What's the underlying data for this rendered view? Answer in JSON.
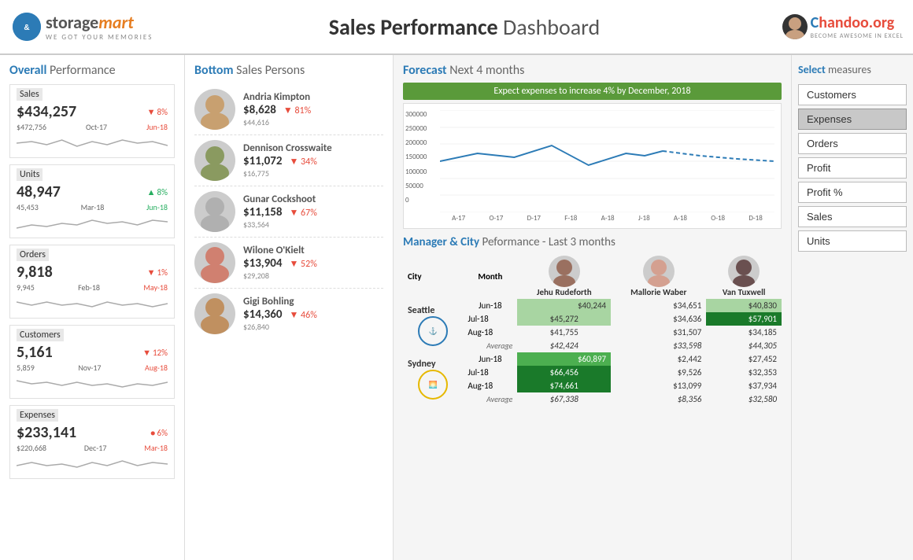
{
  "header": {
    "logo_storage": "storage",
    "logo_mart": "mart",
    "logo_sub": "WE GOT YOUR MEMORIES",
    "title_bold": "Sales Performance",
    "title_light": "Dashboard",
    "chandoo_c": "C",
    "chandoo_rest": "handoo.org",
    "chandoo_sub": "BECOME AWESOME IN EXCEL"
  },
  "left": {
    "section_bold": "Overall",
    "section_light": "Performance",
    "metrics": [
      {
        "label": "Sales",
        "value": "$434,257",
        "change": "8%",
        "direction": "down",
        "prev": "$472,756",
        "date1": "Oct-17",
        "date2": "Jun-18"
      },
      {
        "label": "Units",
        "value": "48,947",
        "change": "8%",
        "direction": "up",
        "prev": "45,453",
        "date1": "Mar-18",
        "date2": "Jun-18"
      },
      {
        "label": "Orders",
        "value": "9,818",
        "change": "1%",
        "direction": "down",
        "prev": "9,945",
        "date1": "Feb-18",
        "date2": "May-18"
      },
      {
        "label": "Customers",
        "value": "5,161",
        "change": "12%",
        "direction": "down",
        "prev": "5,859",
        "date1": "Nov-17",
        "date2": "Aug-18"
      },
      {
        "label": "Expenses",
        "value": "$233,141",
        "change": "6%",
        "direction": "dot",
        "prev": "$220,668",
        "date1": "Dec-17",
        "date2": "Mar-18"
      }
    ]
  },
  "middle": {
    "section_bold": "Bottom",
    "section_light": "Sales Persons",
    "persons": [
      {
        "name": "Andria Kimpton",
        "value": "$8,628",
        "pct": "81%",
        "prev": "$44,616",
        "color": "#c0a080"
      },
      {
        "name": "Dennison Crosswaite",
        "value": "$11,072",
        "pct": "34%",
        "prev": "$16,775",
        "color": "#8a9a60"
      },
      {
        "name": "Gunar Cockshoot",
        "value": "$11,158",
        "pct": "67%",
        "prev": "$33,564",
        "color": "#b0b0b0"
      },
      {
        "name": "Wilone O'Kielt",
        "value": "$13,904",
        "pct": "52%",
        "prev": "$29,208",
        "color": "#c08070"
      },
      {
        "name": "Gigi Bohling",
        "value": "$14,360",
        "pct": "46%",
        "prev": "$26,840",
        "color": "#c09060"
      }
    ]
  },
  "forecast": {
    "bold": "Forecast",
    "light": "Next 4 months",
    "banner": "Expect expenses to increase 4% by December, 2018",
    "y_labels": [
      "300000",
      "250000",
      "200000",
      "150000",
      "100000",
      "50000",
      "0"
    ],
    "x_labels": [
      "A-17",
      "O-17",
      "D-17",
      "F-18",
      "A-18",
      "J-18",
      "A-18",
      "O-18",
      "D-18"
    ]
  },
  "manager": {
    "bold": "Manager & City",
    "light": "Peformance - Last 3 months",
    "managers": [
      {
        "name": "Jehu Rudeforth"
      },
      {
        "name": "Mallorie Waber"
      },
      {
        "name": "Van Tuxwell"
      }
    ],
    "cities": [
      {
        "name": "Seattle",
        "rows": [
          {
            "month": "Jun-18",
            "v1": "$40,244",
            "v2": "$34,651",
            "v3": "$40,830",
            "c1": "cell-green-light",
            "c2": "cell-plain",
            "c3": "cell-green-light"
          },
          {
            "month": "Jul-18",
            "v1": "$45,272",
            "v2": "$34,636",
            "v3": "$57,901",
            "c1": "cell-green-light",
            "c2": "cell-plain",
            "c3": "cell-green-dark"
          },
          {
            "month": "Aug-18",
            "v1": "$41,755",
            "v2": "$31,507",
            "v3": "$34,185",
            "c1": "cell-plain",
            "c2": "cell-plain",
            "c3": "cell-plain"
          }
        ],
        "avg": {
          "v1": "$42,424",
          "v2": "$33,598",
          "v3": "$44,305"
        }
      },
      {
        "name": "Sydney",
        "rows": [
          {
            "month": "Jun-18",
            "v1": "$60,897",
            "v2": "$2,442",
            "v3": "$27,452",
            "c1": "cell-green-mid",
            "c2": "cell-plain",
            "c3": "cell-plain"
          },
          {
            "month": "Jul-18",
            "v1": "$66,456",
            "v2": "$9,526",
            "v3": "$32,353",
            "c1": "cell-green-dark",
            "c2": "cell-plain",
            "c3": "cell-plain"
          },
          {
            "month": "Aug-18",
            "v1": "$74,661",
            "v2": "$13,099",
            "v3": "$37,934",
            "c1": "cell-green-dark",
            "c2": "cell-plain",
            "c3": "cell-plain"
          }
        ],
        "avg": {
          "v1": "$67,338",
          "v2": "$8,356",
          "v3": "$32,580"
        }
      }
    ]
  },
  "select": {
    "bold": "Select",
    "light": "measures",
    "measures": [
      "Customers",
      "Expenses",
      "Orders",
      "Profit",
      "Profit %",
      "Sales",
      "Units"
    ],
    "active": "Expenses"
  }
}
